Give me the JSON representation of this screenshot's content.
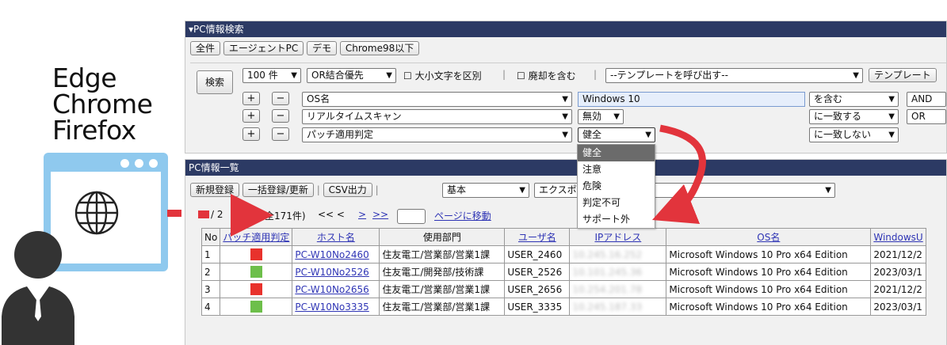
{
  "browsers": [
    "Edge",
    "Chrome",
    "Firefox"
  ],
  "search_panel": {
    "title": "▾PC情報検索",
    "quick_buttons": [
      "全件",
      "エージェントPC",
      "デモ",
      "Chrome98以下"
    ],
    "search_button": "検索",
    "count_select": "100 件",
    "priority_select": "OR結合優先",
    "case_checkbox_label": "大小文字を区別",
    "include_disposed_label": "廃却を含む",
    "template_select": "--テンプレートを呼び出す--",
    "template_button": "テンプレート",
    "conditions": [
      {
        "field": "OS名",
        "value": "Windows 10",
        "op": "を含む",
        "join": "AND"
      },
      {
        "field": "リアルタイムスキャン",
        "value": "無効",
        "op": "に一致する",
        "join": "OR"
      },
      {
        "field": "パッチ適用判定",
        "value": "健全",
        "op": "に一致しない",
        "join": ""
      }
    ],
    "plus": "+",
    "minus": "−"
  },
  "dropdown_options": [
    "健全",
    "注意",
    "危険",
    "判定不可",
    "サポート外"
  ],
  "list_panel": {
    "title": "PC情報一覧",
    "buttons": [
      "新規登録",
      "一括登録/更新",
      "CSV出力"
    ],
    "view_select": "基本",
    "export_button": "エクスポ",
    "pager": {
      "text_left": "/ 2",
      "text_total": "全171件)",
      "nav": "<<  <",
      "next": ">",
      "last": ">>",
      "goto": "ページに移動"
    }
  },
  "table": {
    "headers": [
      "No",
      "パッチ適用判定",
      "ホスト名",
      "使用部門",
      "ユーザ名",
      "IPアドレス",
      "OS名",
      "WindowsU"
    ],
    "rows": [
      {
        "no": "1",
        "status_color": "#e8322c",
        "host": "PC-W10No2460",
        "dept": "住友電工/営業部/営業1課",
        "user": "USER_2460",
        "ip": "10.245.16.252",
        "os": "Microsoft Windows 10 Pro x64 Edition",
        "wu": "2021/12/2"
      },
      {
        "no": "2",
        "status_color": "#6dbf4a",
        "host": "PC-W10No2526",
        "dept": "住友電工/開発部/技術課",
        "user": "USER_2526",
        "ip": "10.101.245.36",
        "os": "Microsoft Windows 10 Pro x64 Edition",
        "wu": "2023/03/1"
      },
      {
        "no": "3",
        "status_color": "#e8322c",
        "host": "PC-W10No2656",
        "dept": "住友電工/営業部/営業1課",
        "user": "USER_2656",
        "ip": "10.254.201.78",
        "os": "Microsoft Windows 10 Pro x64 Edition",
        "wu": "2021/12/2"
      },
      {
        "no": "4",
        "status_color": "#6dbf4a",
        "host": "PC-W10No3335",
        "dept": "住友電工/営業部/営業1課",
        "user": "USER_3335",
        "ip": "10.245.187.33",
        "os": "Microsoft Windows 10 Pro x64 Edition",
        "wu": "2023/03/1"
      }
    ]
  },
  "colors": {
    "header": "#2c3a64",
    "accent_red": "#e2343c",
    "browser_blue": "#8fc9ee"
  }
}
